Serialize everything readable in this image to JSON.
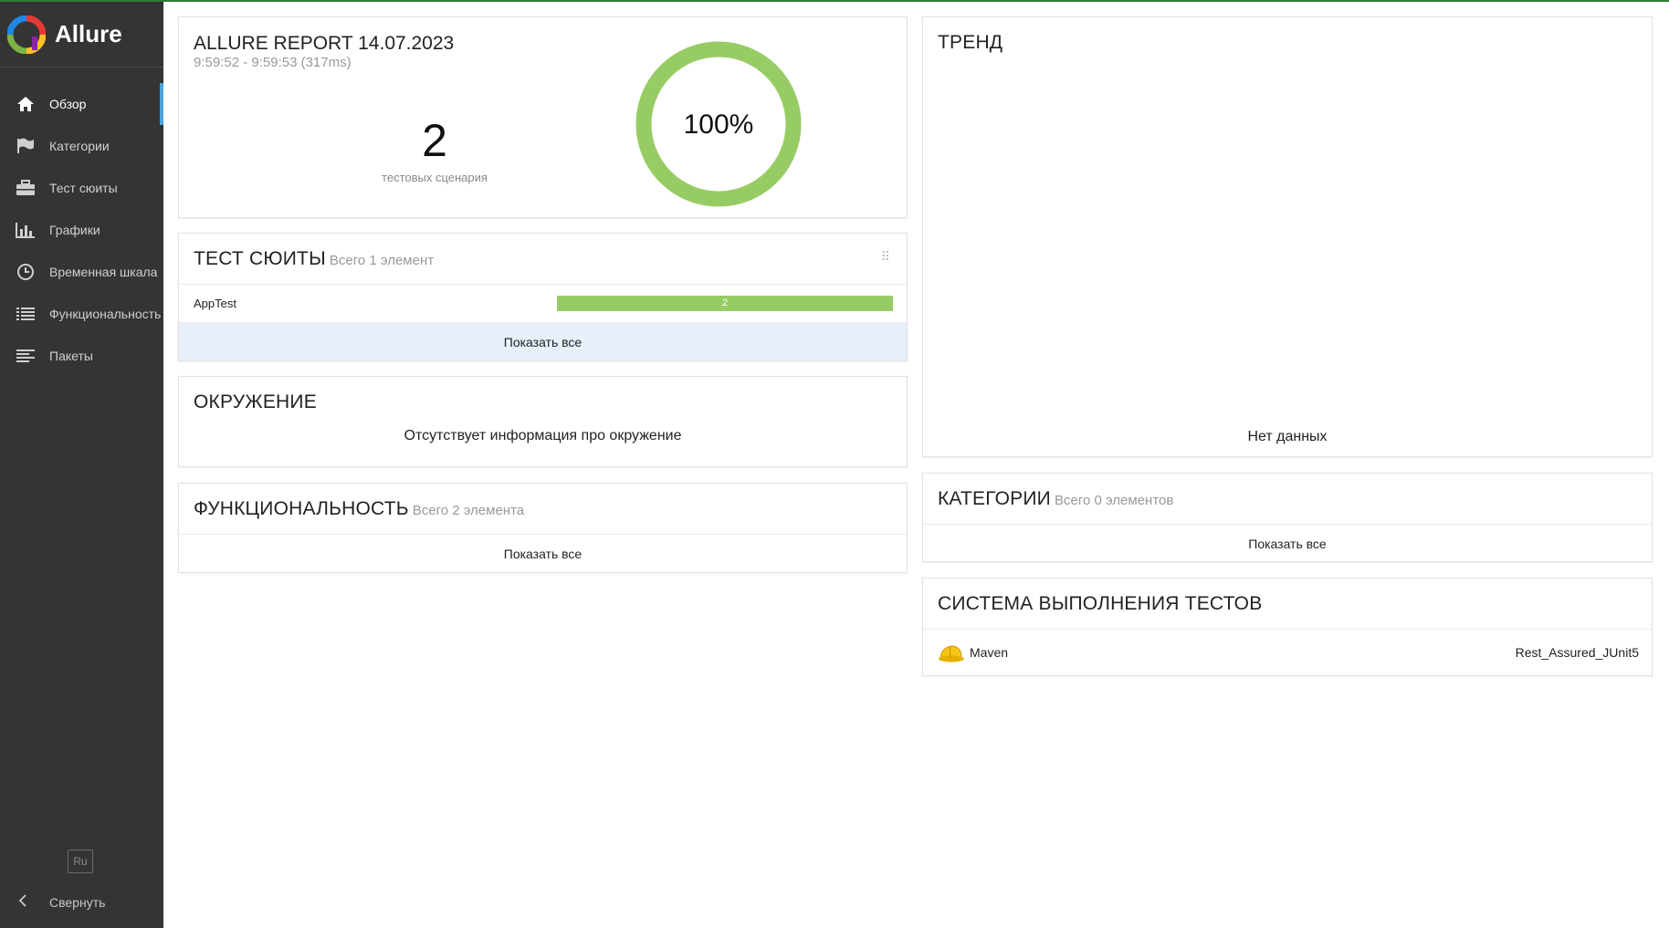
{
  "brand": {
    "name": "Allure"
  },
  "sidebar": {
    "items": [
      {
        "label": "Обзор",
        "icon": "home-icon",
        "active": true
      },
      {
        "label": "Категории",
        "icon": "flag-icon"
      },
      {
        "label": "Тест сюиты",
        "icon": "briefcase-icon"
      },
      {
        "label": "Графики",
        "icon": "bar-chart-icon"
      },
      {
        "label": "Временная шкала",
        "icon": "clock-icon"
      },
      {
        "label": "Функциональность",
        "icon": "list-icon"
      },
      {
        "label": "Пакеты",
        "icon": "align-left-icon"
      }
    ],
    "language": "Ru",
    "collapse_label": "Свернуть"
  },
  "summary": {
    "title": "ALLURE REPORT 14.07.2023",
    "time": "9:59:52 - 9:59:53 (317ms)",
    "test_count": "2",
    "test_count_label": "тестовых сценария",
    "success_rate": "100%",
    "success_fraction": 1.0,
    "color": "#97cc64"
  },
  "suites": {
    "title": "ТЕСТ СЮИТЫ",
    "subtitle": "Всего 1 элемент",
    "rows": [
      {
        "name": "AppTest",
        "passed": "2"
      }
    ],
    "show_all": "Показать все"
  },
  "environment": {
    "title": "ОКРУЖЕНИЕ",
    "message": "Отсутствует информация про окружение"
  },
  "features": {
    "title": "ФУНКЦИОНАЛЬНОСТЬ",
    "subtitle": "Всего 2 элемента",
    "show_all": "Показать все"
  },
  "trend": {
    "title": "ТРЕНД",
    "no_data": "Нет данных"
  },
  "categories": {
    "title": "КАТЕГОРИИ",
    "subtitle": "Всего 0 элементов",
    "show_all": "Показать все"
  },
  "executors": {
    "title": "СИСТЕМА ВЫПОЛНЕНИЯ ТЕСТОВ",
    "rows": [
      {
        "name": "Maven",
        "build": "Rest_Assured_JUnit5",
        "icon": "maven-hat-icon"
      }
    ]
  },
  "colors": {
    "sidebar_bg": "#343434",
    "accent": "#4aa3df",
    "passed": "#97cc64",
    "show_all_bg": "#e6effa"
  }
}
